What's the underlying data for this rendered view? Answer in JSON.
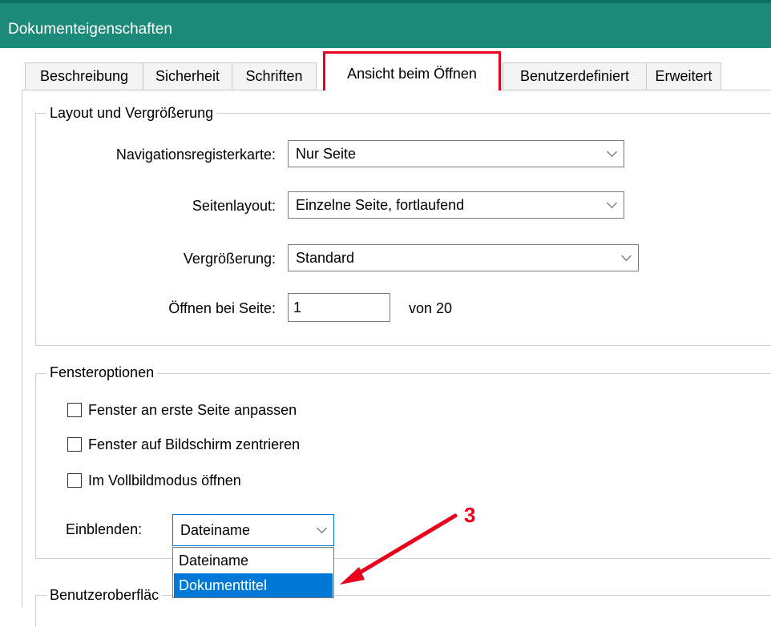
{
  "window": {
    "title": "Dokumenteigenschaften"
  },
  "tabs": [
    {
      "label": "Beschreibung"
    },
    {
      "label": "Sicherheit"
    },
    {
      "label": "Schriften"
    },
    {
      "label": "Ansicht beim Öffnen"
    },
    {
      "label": "Benutzerdefiniert"
    },
    {
      "label": "Erweitert"
    }
  ],
  "layout_group": {
    "legend": "Layout und Vergrößerung",
    "nav_label": "Navigationsregisterkarte:",
    "nav_value": "Nur Seite",
    "pagelayout_label": "Seitenlayout:",
    "pagelayout_value": "Einzelne Seite, fortlaufend",
    "zoom_label": "Vergrößerung:",
    "zoom_value": "Standard",
    "openpage_label": "Öffnen bei Seite:",
    "openpage_value": "1",
    "of_pages": "von 20"
  },
  "window_group": {
    "legend": "Fensteroptionen",
    "cb_fit": "Fenster an erste Seite anpassen",
    "cb_center": "Fenster auf Bildschirm zentrieren",
    "cb_fullscreen": "Im Vollbildmodus öffnen",
    "show_label": "Einblenden:",
    "show_value": "Dateiname",
    "options": [
      "Dateiname",
      "Dokumenttitel"
    ]
  },
  "ui_group": {
    "legend": "Benutzeroberfläc"
  },
  "annotation": {
    "number": "3",
    "color": "#e8001c"
  }
}
